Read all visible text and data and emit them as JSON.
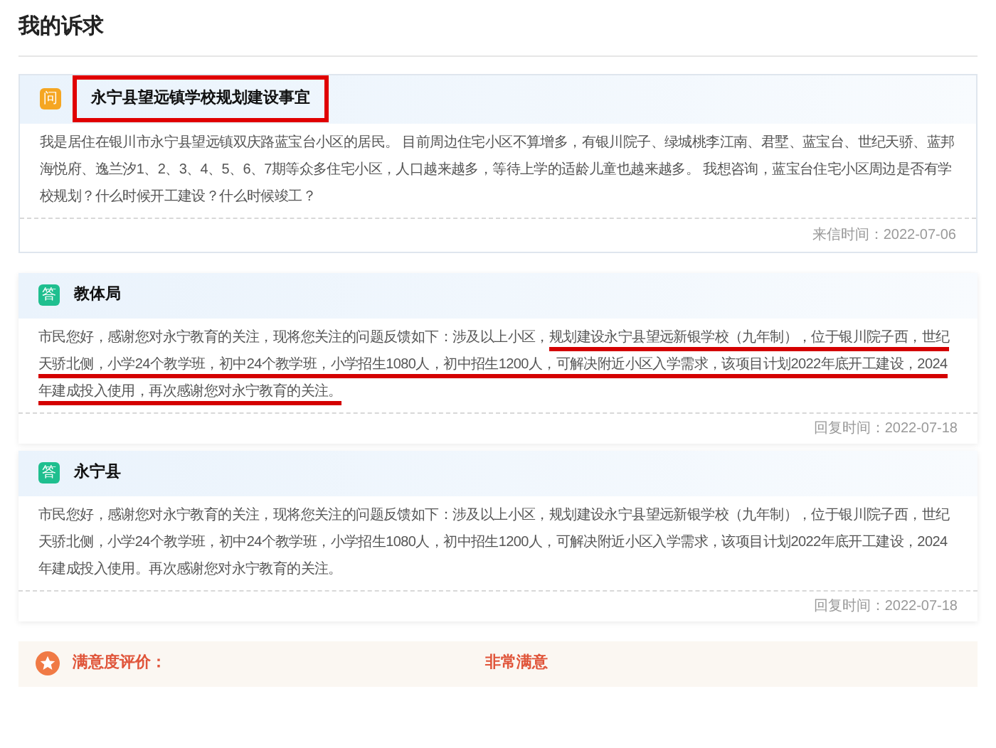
{
  "page_title": "我的诉求",
  "question": {
    "badge": "问",
    "title": "永宁县望远镇学校规划建设事宜",
    "boxed": true,
    "body": "我是居住在银川市永宁县望远镇双庆路蓝宝台小区的居民。 目前周边住宅小区不算增多，有银川院子、绿城桃李江南、君墅、蓝宝台、世纪天骄、蓝邦海悦府、逸兰汐1、2、3、4、5、6、7期等众多住宅小区，人口越来越多，等待上学的适龄儿童也越来越多。 我想咨询，蓝宝台住宅小区周边是否有学校规划？什么时候开工建设？什么时候竣工？",
    "footer": "来信时间：2022-07-06"
  },
  "answers": [
    {
      "badge": "答",
      "department": "教体局",
      "body_parts": [
        {
          "text": "市民您好，感谢您对永宁教育的关注，现将您关注的问题反馈如下：涉及以上小区，",
          "underlined": false
        },
        {
          "text": "规划建设永宁县望远新银学校（九年制），位于银川院子西，世纪天骄北侧，小学24个教学班，初中24个教学班，小学招生1080人，初中招生1200人，可解决附近小区入学需求，该项目计划2022年底开工建设，2024年建成投入使用，再次感谢您对永宁教育的关注。",
          "underlined": true
        }
      ],
      "footer": "回复时间：2022-07-18"
    },
    {
      "badge": "答",
      "department": "永宁县",
      "body_parts": [
        {
          "text": "市民您好，感谢您对永宁教育的关注，现将您关注的问题反馈如下：涉及以上小区，规划建设永宁县望远新银学校（九年制），位于银川院子西，世纪天骄北侧，小学24个教学班，初中24个教学班，小学招生1080人，初中招生1200人，可解决附近小区入学需求，该项目计划2022年底开工建设，2024年建成投入使用。再次感谢您对永宁教育的关注。",
          "underlined": false
        }
      ],
      "footer": "回复时间：2022-07-18"
    }
  ],
  "rating": {
    "label": "满意度评价：",
    "value": "非常满意"
  }
}
